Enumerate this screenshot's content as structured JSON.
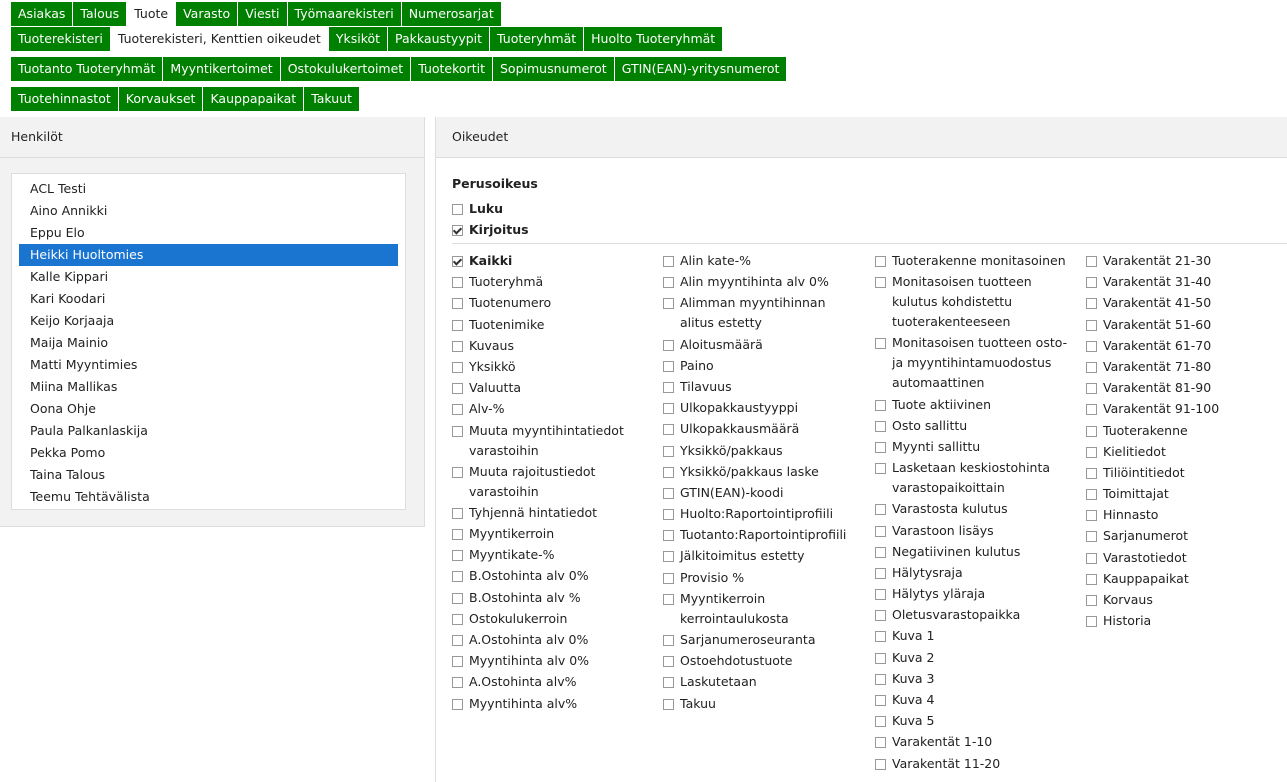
{
  "tabs": {
    "row1": [
      "Asiakas",
      "Talous",
      "Tuote",
      "Varasto",
      "Viesti",
      "Työmaarekisteri",
      "Numerosarjat"
    ],
    "row1_active": 2,
    "row2": [
      "Tuoterekisteri",
      "Tuoterekisteri, Kenttien oikeudet",
      "Yksiköt",
      "Pakkaustyypit",
      "Tuoteryhmät",
      "Huolto Tuoteryhmät"
    ],
    "row2_active": 1,
    "row3": [
      "Tuotanto Tuoteryhmät",
      "Myyntikertoimet",
      "Ostokulukertoimet",
      "Tuotekortit",
      "Sopimusnumerot",
      "GTIN(EAN)-yritysnumerot"
    ],
    "row4": [
      "Tuotehinnastot",
      "Korvaukset",
      "Kauppapaikat",
      "Takuut"
    ]
  },
  "left": {
    "title": "Henkilöt",
    "persons": [
      "ACL Testi",
      "Aino Annikki",
      "Eppu Elo",
      "Heikki Huoltomies",
      "Kalle Kippari",
      "Kari Koodari",
      "Keijo Korjaaja",
      "Maija Mainio",
      "Matti Myyntimies",
      "Miina Mallikas",
      "Oona Ohje",
      "Paula Palkanlaskija",
      "Pekka Pomo",
      "Taina Talous",
      "Teemu Tehtävälista"
    ],
    "selected": 3
  },
  "right": {
    "title": "Oikeudet",
    "section": "Perusoikeus",
    "basic": [
      {
        "label": "Luku",
        "checked": false
      },
      {
        "label": "Kirjoitus",
        "checked": true
      }
    ],
    "columns": [
      [
        {
          "label": "Kaikki",
          "checked": true,
          "bold": true
        },
        {
          "label": "Tuoteryhmä",
          "checked": false
        },
        {
          "label": "Tuotenumero",
          "checked": false
        },
        {
          "label": "Tuotenimike",
          "checked": false
        },
        {
          "label": "Kuvaus",
          "checked": false
        },
        {
          "label": "Yksikkö",
          "checked": false
        },
        {
          "label": "Valuutta",
          "checked": false
        },
        {
          "label": "Alv-%",
          "checked": false
        },
        {
          "label": "Muuta myyntihintatiedot varastoihin",
          "checked": false
        },
        {
          "label": "Muuta rajoitustiedot varastoihin",
          "checked": false
        },
        {
          "label": "Tyhjennä hintatiedot",
          "checked": false
        },
        {
          "label": "Myyntikerroin",
          "checked": false
        },
        {
          "label": "Myyntikate-%",
          "checked": false
        },
        {
          "label": "B.Ostohinta alv 0%",
          "checked": false
        },
        {
          "label": "B.Ostohinta alv %",
          "checked": false
        },
        {
          "label": "Ostokulukerroin",
          "checked": false
        },
        {
          "label": "A.Ostohinta alv 0%",
          "checked": false
        },
        {
          "label": "Myyntihinta alv 0%",
          "checked": false
        },
        {
          "label": "A.Ostohinta alv%",
          "checked": false
        },
        {
          "label": "Myyntihinta alv%",
          "checked": false
        }
      ],
      [
        {
          "label": "Alin kate-%",
          "checked": false
        },
        {
          "label": "Alin myyntihinta alv 0%",
          "checked": false
        },
        {
          "label": "Alimman myyntihinnan alitus estetty",
          "checked": false
        },
        {
          "label": "Aloitusmäärä",
          "checked": false
        },
        {
          "label": "Paino",
          "checked": false
        },
        {
          "label": "Tilavuus",
          "checked": false
        },
        {
          "label": "Ulkopakkaustyyppi",
          "checked": false
        },
        {
          "label": "Ulkopakkausmäärä",
          "checked": false
        },
        {
          "label": "Yksikkö/pakkaus",
          "checked": false
        },
        {
          "label": "Yksikkö/pakkaus laske",
          "checked": false
        },
        {
          "label": "GTIN(EAN)-koodi",
          "checked": false
        },
        {
          "label": "Huolto:Raportointiprofiili",
          "checked": false
        },
        {
          "label": "Tuotanto:Raportointiprofiili",
          "checked": false
        },
        {
          "label": "Jälkitoimitus estetty",
          "checked": false
        },
        {
          "label": "Provisio %",
          "checked": false
        },
        {
          "label": "Myyntikerroin kerrointaulukosta",
          "checked": false
        },
        {
          "label": "Sarjanumeroseuranta",
          "checked": false
        },
        {
          "label": "Ostoehdotustuote",
          "checked": false
        },
        {
          "label": "Laskutetaan",
          "checked": false
        },
        {
          "label": "Takuu",
          "checked": false
        }
      ],
      [
        {
          "label": "Tuoterakenne monitasoinen",
          "checked": false
        },
        {
          "label": "Monitasoisen tuotteen kulutus kohdistettu tuoterakenteeseen",
          "checked": false
        },
        {
          "label": "Monitasoisen tuotteen osto- ja myyntihintamuodostus automaattinen",
          "checked": false
        },
        {
          "label": "Tuote aktiivinen",
          "checked": false
        },
        {
          "label": "Osto sallittu",
          "checked": false
        },
        {
          "label": "Myynti sallittu",
          "checked": false
        },
        {
          "label": "Lasketaan keskiostohinta varastopaikoittain",
          "checked": false
        },
        {
          "label": "Varastosta kulutus",
          "checked": false
        },
        {
          "label": "Varastoon lisäys",
          "checked": false
        },
        {
          "label": "Negatiivinen kulutus",
          "checked": false
        },
        {
          "label": "Hälytysraja",
          "checked": false
        },
        {
          "label": "Hälytys yläraja",
          "checked": false
        },
        {
          "label": "Oletusvarastopaikka",
          "checked": false
        },
        {
          "label": "Kuva 1",
          "checked": false
        },
        {
          "label": "Kuva 2",
          "checked": false
        },
        {
          "label": "Kuva 3",
          "checked": false
        },
        {
          "label": "Kuva 4",
          "checked": false
        },
        {
          "label": "Kuva 5",
          "checked": false
        },
        {
          "label": "Varakentät 1-10",
          "checked": false
        },
        {
          "label": "Varakentät 11-20",
          "checked": false
        }
      ],
      [
        {
          "label": "Varakentät 21-30",
          "checked": false
        },
        {
          "label": "Varakentät 31-40",
          "checked": false
        },
        {
          "label": "Varakentät 41-50",
          "checked": false
        },
        {
          "label": "Varakentät 51-60",
          "checked": false
        },
        {
          "label": "Varakentät 61-70",
          "checked": false
        },
        {
          "label": "Varakentät 71-80",
          "checked": false
        },
        {
          "label": "Varakentät 81-90",
          "checked": false
        },
        {
          "label": "Varakentät 91-100",
          "checked": false
        },
        {
          "label": "Tuoterakenne",
          "checked": false
        },
        {
          "label": "Kielitiedot",
          "checked": false
        },
        {
          "label": "Tiliöintitiedot",
          "checked": false
        },
        {
          "label": "Toimittajat",
          "checked": false
        },
        {
          "label": "Hinnasto",
          "checked": false
        },
        {
          "label": "Sarjanumerot",
          "checked": false
        },
        {
          "label": "Varastotiedot",
          "checked": false
        },
        {
          "label": "Kauppapaikat",
          "checked": false
        },
        {
          "label": "Korvaus",
          "checked": false
        },
        {
          "label": "Historia",
          "checked": false
        }
      ]
    ]
  }
}
